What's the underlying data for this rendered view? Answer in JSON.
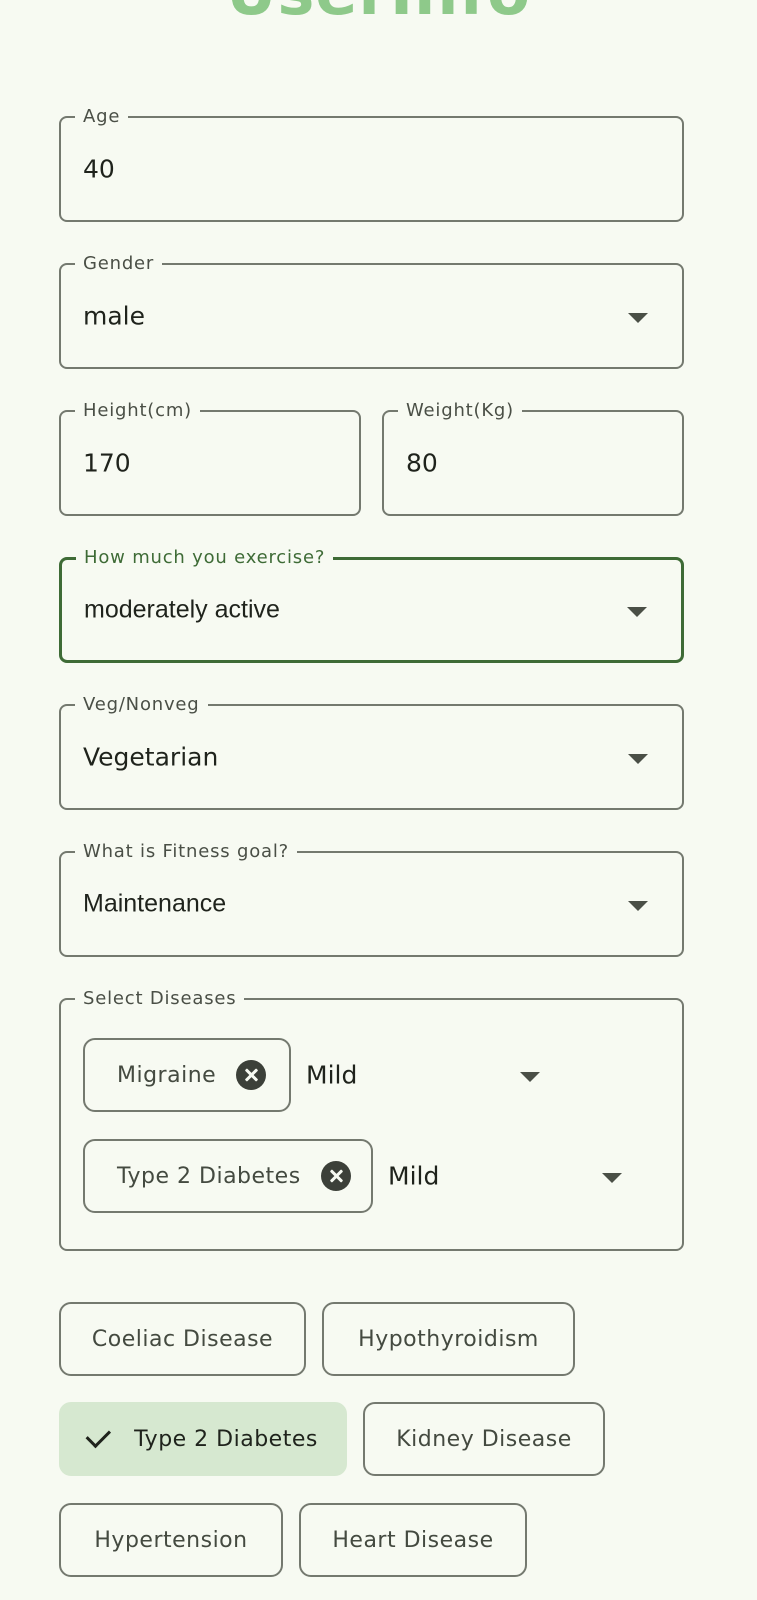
{
  "page": {
    "title": "UserInfo"
  },
  "form": {
    "age": {
      "label": "Age",
      "value": "40"
    },
    "gender": {
      "label": "Gender",
      "value": "male"
    },
    "height": {
      "label": "Height(cm)",
      "value": "170"
    },
    "weight": {
      "label": "Weight(Kg)",
      "value": "80"
    },
    "exercise": {
      "label": "How much you exercise?",
      "value": "moderately active"
    },
    "diet": {
      "label": "Veg/Nonveg",
      "value": "Vegetarian"
    },
    "goal": {
      "label": "What is Fitness goal?",
      "value": "Maintenance"
    },
    "diseases": {
      "label": "Select Diseases",
      "selected": [
        {
          "name": "Migraine",
          "severity": "Mild"
        },
        {
          "name": "Type 2 Diabetes",
          "severity": "Mild"
        }
      ]
    }
  },
  "disease_chips": [
    {
      "label": "Coeliac Disease",
      "selected": false
    },
    {
      "label": "Hypothyroidism",
      "selected": false
    },
    {
      "label": "Type 2 Diabetes",
      "selected": true
    },
    {
      "label": "Kidney Disease",
      "selected": false
    },
    {
      "label": "Hypertension",
      "selected": false
    },
    {
      "label": "Heart Disease",
      "selected": false
    }
  ],
  "icons": {
    "dropdown": "arrow-drop-down-icon",
    "remove": "cancel-icon",
    "check": "check-icon"
  },
  "colors": {
    "background": "#f7faf2",
    "title": "#8ec98a",
    "focused_outline": "#3e6b36",
    "selected_chip": "#d6e8d0"
  }
}
